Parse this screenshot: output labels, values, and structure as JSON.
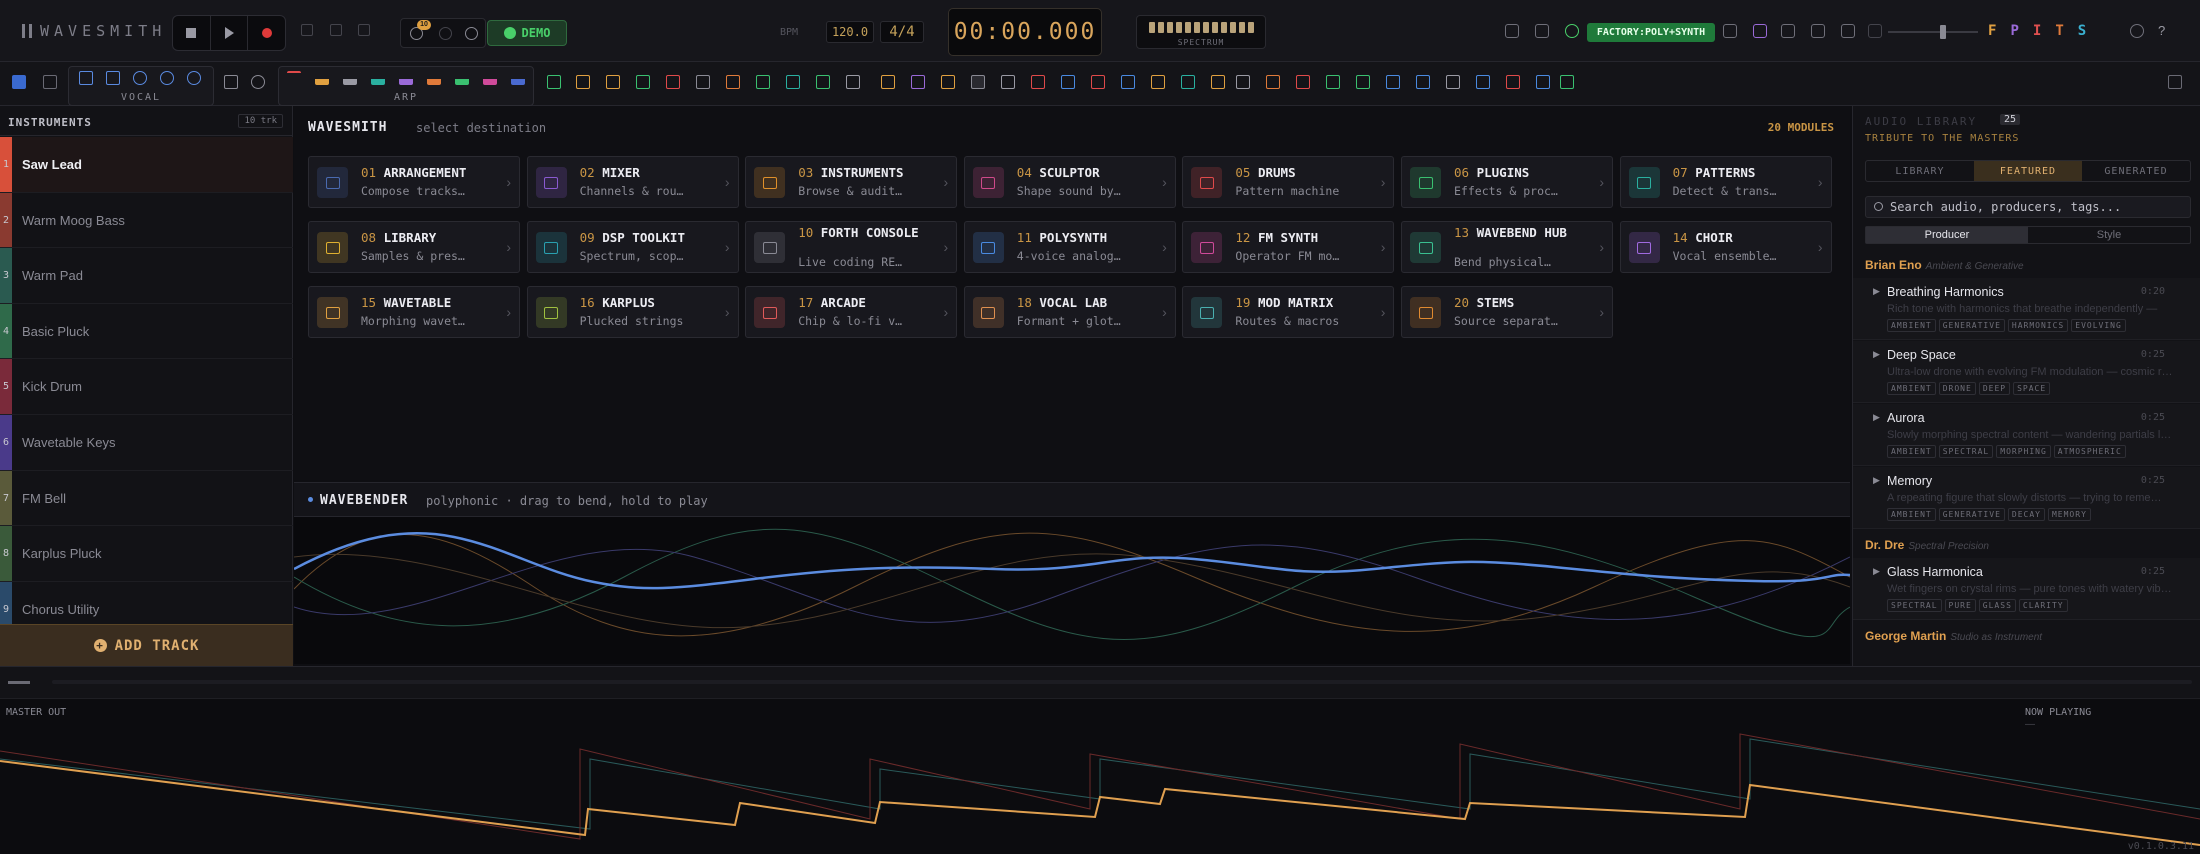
{
  "app": {
    "name": "WAVESMITH",
    "version": "v0.1.0.3.11"
  },
  "topbar": {
    "history_count": "10",
    "demo_label": "DEMO",
    "bpm_label": "BPM",
    "bpm_value": "120.0",
    "time_signature": "4/4",
    "clock": "00:00.000",
    "spectrum_label": "SPECTRUM",
    "factory_label": "FACTORY:POLY+SYNTH",
    "letters": [
      {
        "label": "F",
        "color": "#e0a040"
      },
      {
        "label": "P",
        "color": "#9a6ad8"
      },
      {
        "label": "I",
        "color": "#e05050"
      },
      {
        "label": "T",
        "color": "#e07a3a"
      },
      {
        "label": "S",
        "color": "#3ab0d0"
      }
    ]
  },
  "toolbar": {
    "group_vocal": "VOCAL",
    "group_arp": "ARP"
  },
  "instruments": {
    "title": "INSTRUMENTS",
    "count": "10 trk",
    "add_label": "ADD TRACK",
    "tracks": [
      {
        "num": "1",
        "name": "Saw Lead",
        "color": "#d8503a"
      },
      {
        "num": "2",
        "name": "Warm Moog Bass",
        "color": "#8a3a30"
      },
      {
        "num": "3",
        "name": "Warm Pad",
        "color": "#2a5a50"
      },
      {
        "num": "4",
        "name": "Basic Pluck",
        "color": "#2f6a4a"
      },
      {
        "num": "5",
        "name": "Kick Drum",
        "color": "#7a2a3a"
      },
      {
        "num": "6",
        "name": "Wavetable Keys",
        "color": "#4a3a8a"
      },
      {
        "num": "7",
        "name": "FM Bell",
        "color": "#5a5a3a"
      },
      {
        "num": "8",
        "name": "Karplus Pluck",
        "color": "#3a5a3a"
      },
      {
        "num": "9",
        "name": "Chorus Utility",
        "color": "#2a4a6a"
      }
    ]
  },
  "main": {
    "title": "WAVESMITH",
    "subtitle": "select destination",
    "modules_count": "20 MODULES",
    "modules": [
      {
        "num": "01",
        "name": "ARRANGEMENT",
        "desc": "Compose tracks…",
        "color": "#4a6ab0"
      },
      {
        "num": "02",
        "name": "MIXER",
        "desc": "Channels & rou…",
        "color": "#8a5ad0"
      },
      {
        "num": "03",
        "name": "INSTRUMENTS",
        "desc": "Browse & audit…",
        "color": "#e0902a"
      },
      {
        "num": "04",
        "name": "SCULPTOR",
        "desc": "Shape sound by…",
        "color": "#d04a8a"
      },
      {
        "num": "05",
        "name": "DRUMS",
        "desc": "Pattern machine",
        "color": "#e04a4a"
      },
      {
        "num": "06",
        "name": "PLUGINS",
        "desc": "Effects & proc…",
        "color": "#3ac070"
      },
      {
        "num": "07",
        "name": "PATTERNS",
        "desc": "Detect & trans…",
        "color": "#2ab0a0"
      },
      {
        "num": "08",
        "name": "LIBRARY",
        "desc": "Samples & pres…",
        "color": "#e0b030"
      },
      {
        "num": "09",
        "name": "DSP TOOLKIT",
        "desc": "Spectrum, scop…",
        "color": "#2aa0b0"
      },
      {
        "num": "10",
        "name": "FORTH CONSOLE",
        "desc": "Live coding RE…",
        "color": "#8a8a94"
      },
      {
        "num": "11",
        "name": "POLYSYNTH",
        "desc": "4-voice analog…",
        "color": "#4a8ae0"
      },
      {
        "num": "12",
        "name": "FM SYNTH",
        "desc": "Operator FM mo…",
        "color": "#d04a9a"
      },
      {
        "num": "13",
        "name": "WAVEBEND HUB",
        "desc": "Bend physical…",
        "color": "#3ac090"
      },
      {
        "num": "14",
        "name": "CHOIR",
        "desc": "Vocal ensemble…",
        "color": "#a06ae0"
      },
      {
        "num": "15",
        "name": "WAVETABLE",
        "desc": "Morphing wavet…",
        "color": "#e0a040"
      },
      {
        "num": "16",
        "name": "KARPLUS",
        "desc": "Plucked strings",
        "color": "#a0c040"
      },
      {
        "num": "17",
        "name": "ARCADE",
        "desc": "Chip & lo-fi v…",
        "color": "#e05a5a"
      },
      {
        "num": "18",
        "name": "VOCAL LAB",
        "desc": "Formant + glot…",
        "color": "#e09050"
      },
      {
        "num": "19",
        "name": "MOD MATRIX",
        "desc": "Routes & macros",
        "color": "#4ab0b0"
      },
      {
        "num": "20",
        "name": "STEMS",
        "desc": "Source separat…",
        "color": "#e08a30"
      }
    ]
  },
  "wavebender": {
    "title": "WAVEBENDER",
    "subtitle": "polyphonic · drag to bend, hold to play"
  },
  "library": {
    "title": "AUDIO LIBRARY",
    "count": "25",
    "subtitle": "TRIBUTE TO THE MASTERS",
    "tabs": [
      "LIBRARY",
      "FEATURED",
      "GENERATED"
    ],
    "search_placeholder": "Search audio, producers, tags...",
    "group_by": [
      "Producer",
      "Style"
    ],
    "producers": [
      {
        "name": "Brian Eno",
        "style": "Ambient & Generative",
        "items": [
          {
            "name": "Breathing Harmonics",
            "dur": "0:20",
            "desc": "Rich tone with harmonics that breathe independently —",
            "tags": [
              "AMBIENT",
              "GENERATIVE",
              "HARMONICS",
              "EVOLVING"
            ]
          },
          {
            "name": "Deep Space",
            "dur": "0:25",
            "desc": "Ultra-low drone with evolving FM modulation — cosmic r…",
            "tags": [
              "AMBIENT",
              "DRONE",
              "DEEP",
              "SPACE"
            ]
          },
          {
            "name": "Aurora",
            "dur": "0:25",
            "desc": "Slowly morphing spectral content — wandering partials l…",
            "tags": [
              "AMBIENT",
              "SPECTRAL",
              "MORPHING",
              "ATMOSPHERIC"
            ]
          },
          {
            "name": "Memory",
            "dur": "0:25",
            "desc": "A repeating figure that slowly distorts — trying to reme…",
            "tags": [
              "AMBIENT",
              "GENERATIVE",
              "DECAY",
              "MEMORY"
            ]
          }
        ]
      },
      {
        "name": "Dr. Dre",
        "style": "Spectral Precision",
        "items": [
          {
            "name": "Glass Harmonica",
            "dur": "0:25",
            "desc": "Wet fingers on crystal rims — pure tones with watery vib…",
            "tags": [
              "SPECTRAL",
              "PURE",
              "GLASS",
              "CLARITY"
            ]
          }
        ]
      },
      {
        "name": "George Martin",
        "style": "Studio as Instrument",
        "items": []
      }
    ]
  },
  "master": {
    "label": "MASTER OUT",
    "now_playing_label": "NOW PLAYING",
    "now_playing_value": "—"
  }
}
